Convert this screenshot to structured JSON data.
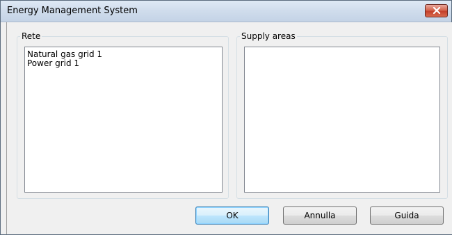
{
  "window": {
    "title": "Energy Management System"
  },
  "icons": {
    "close": "close-icon"
  },
  "rete": {
    "label": "Rete",
    "items": [
      "Natural gas grid 1",
      "Power grid 1"
    ]
  },
  "supply_areas": {
    "label": "Supply areas",
    "items": []
  },
  "buttons": {
    "ok": "OK",
    "cancel": "Annulla",
    "help": "Guida"
  },
  "colors": {
    "close_button": "#c4402b",
    "default_button_border": "#3c7fb1"
  }
}
